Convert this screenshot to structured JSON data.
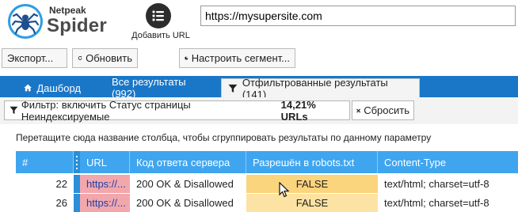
{
  "app": {
    "brand_small": "Netpeak",
    "brand_big": "Spider"
  },
  "header": {
    "add_url_label": "Добавить URL",
    "url_value": "https://mysupersite.com"
  },
  "toolbar": {
    "export_label": "Экспорт...",
    "refresh_label": "Обновить",
    "segment_label": "Настроить сегмент..."
  },
  "tabs": [
    {
      "label": "Дашборд",
      "icon": "home-icon"
    },
    {
      "label": "Все результаты (992)"
    },
    {
      "label": "Отфильтрованные результаты (141)",
      "icon": "filter-icon",
      "active": true
    }
  ],
  "filter": {
    "text": "Фильтр: включить Статус страницы Неиндексируемые",
    "percent": "14,21% URLs",
    "reset_label": "Сбросить"
  },
  "group_hint": "Перетащите сюда название столбца, чтобы сгруппировать результаты по данному параметру",
  "grid": {
    "columns": [
      "#",
      "URL",
      "Код ответа сервера",
      "Разрешён в robots.txt",
      "Content-Type"
    ],
    "rows": [
      {
        "num": "22",
        "url": "https://...",
        "code": "200 OK & Disallowed",
        "robots": "FALSE",
        "ctype": "text/html; charset=utf-8"
      },
      {
        "num": "26",
        "url": "https://...",
        "code": "200 OK & Disallowed",
        "robots": "FALSE",
        "ctype": "text/html; charset=utf-8"
      }
    ]
  },
  "colors": {
    "accent": "#1a77c8",
    "grid_header": "#3fa5ef",
    "url_cell": "#f2a7ad",
    "robots_cell": "#fde3a3",
    "robots_cell_active": "#fbd47e"
  }
}
